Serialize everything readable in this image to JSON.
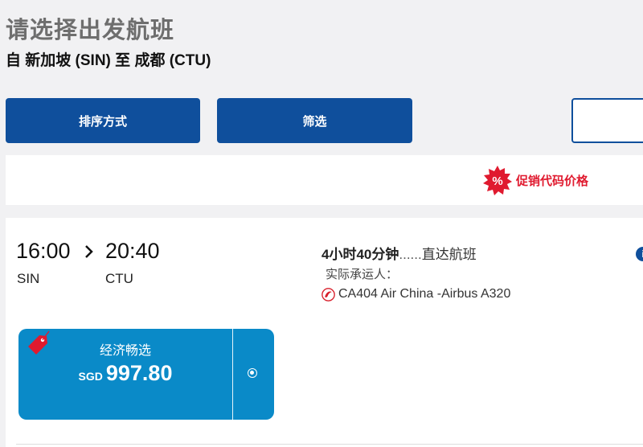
{
  "header": {
    "title": "请选择出发航班",
    "route": "自 新加坡 (SIN) 至 成都 (CTU)"
  },
  "toolbar": {
    "sort_label": "排序方式",
    "filter_label": "筛选",
    "third_label": ""
  },
  "promo": {
    "badge_symbol": "%",
    "label": "促销代码价格",
    "color": "#e01a2f"
  },
  "flight": {
    "depart_time": "16:00",
    "depart_code": "SIN",
    "arrive_time": "20:40",
    "arrive_code": "CTU",
    "duration": "4小时40分钟",
    "dots": "......",
    "stop_type": "直达航班",
    "operated_by": "实际承运人：",
    "carrier": "CA404 Air China -Airbus A320",
    "info_icon_symbol": "i"
  },
  "fare": {
    "name": "经济畅选",
    "currency": "SGD",
    "amount": "997.80",
    "color": "#0a8ac8"
  },
  "colors": {
    "primary": "#0f4f9c",
    "fare": "#0a8ac8",
    "promo": "#e01a2f"
  }
}
